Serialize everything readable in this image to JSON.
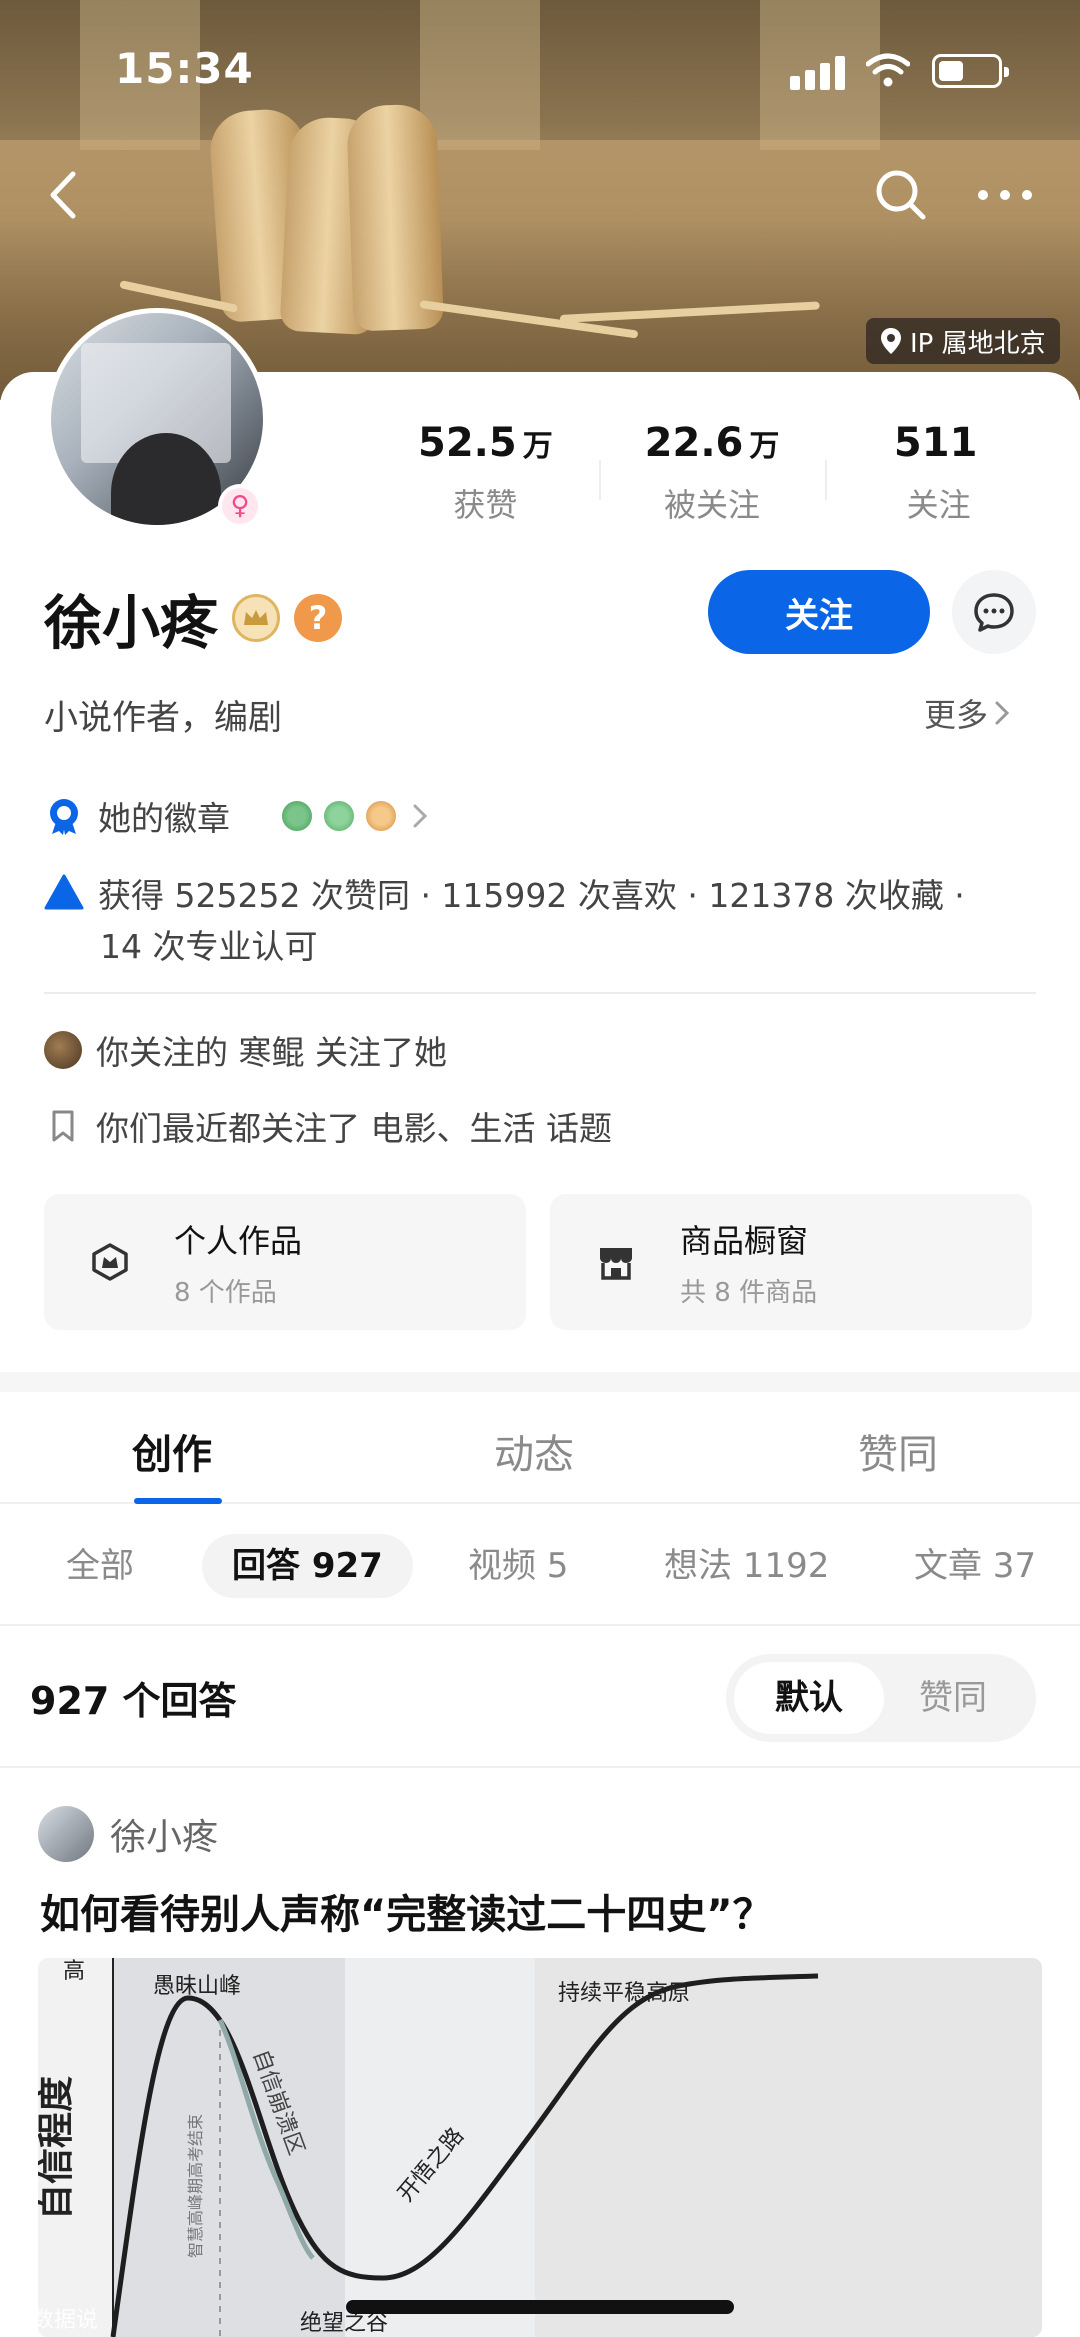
{
  "status_bar": {
    "time": "15:34"
  },
  "header": {
    "ip_location": "IP 属地北京"
  },
  "profile": {
    "name": "徐小疼",
    "bio": "小说作者，编剧",
    "more_label": "更多",
    "follow_button": "关注"
  },
  "stats": [
    {
      "value": "52.5",
      "unit": "万",
      "label": "获赞"
    },
    {
      "value": "22.6",
      "unit": "万",
      "label": "被关注"
    },
    {
      "value": "511",
      "unit": "",
      "label": "关注"
    }
  ],
  "badges_row": {
    "label": "她的徽章"
  },
  "achievements": {
    "text": "获得 525252 次赞同 · 115992 次喜欢 · 121378 次收藏 ·",
    "text2": "14 次专业认可"
  },
  "social": {
    "followed_by": "你关注的 寒鲲 关注了她",
    "topics": "你们最近都关注了 电影、生活 话题"
  },
  "tiles": [
    {
      "title": "个人作品",
      "subtitle": "8 个作品"
    },
    {
      "title": "商品橱窗",
      "subtitle": "共 8 件商品"
    }
  ],
  "tabs": [
    "创作",
    "动态",
    "赞同"
  ],
  "subtabs": [
    "全部",
    "回答 927",
    "视频 5",
    "想法 1192",
    "文章 37"
  ],
  "answers": {
    "count_label": "927 个回答",
    "sort_options": [
      "默认",
      "赞同"
    ]
  },
  "post": {
    "author": "徐小疼",
    "title": "如何看待别人声称“完整读过二十四史”？"
  },
  "chart_data": {
    "type": "line",
    "ylabel": "自信程度",
    "y_tick_top": "高",
    "annotations": [
      "愚昧山峰",
      "自信崩溃区",
      "绝望之谷",
      "开悟之路",
      "持续平稳高原",
      "智慧高峰期高考结束"
    ]
  },
  "watermark": "大数据说"
}
